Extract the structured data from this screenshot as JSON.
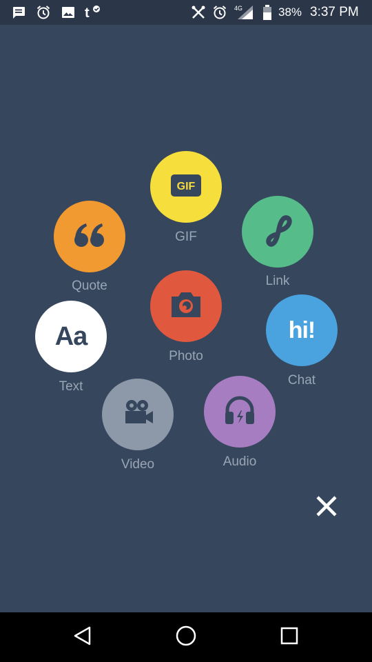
{
  "status_bar": {
    "network": "4G",
    "battery": "38%",
    "time": "3:37 PM",
    "left_icons": [
      "message-icon",
      "alarm-icon",
      "image-icon",
      "tumblr-icon"
    ],
    "right_icons": [
      "tools-icon",
      "alarm-icon",
      "signal-icon",
      "battery-icon"
    ]
  },
  "post_types": {
    "gif": {
      "label": "GIF",
      "icon_text": "GIF",
      "color": "#f6de3d"
    },
    "quote": {
      "label": "Quote",
      "color": "#f29a32"
    },
    "link": {
      "label": "Link",
      "color": "#56bc8a"
    },
    "photo": {
      "label": "Photo",
      "color": "#e0583d"
    },
    "text": {
      "label": "Text",
      "icon_text": "Aa",
      "color": "#ffffff"
    },
    "chat": {
      "label": "Chat",
      "icon_text": "hi!",
      "color": "#4aa3df"
    },
    "video": {
      "label": "Video",
      "color": "#8d99a8"
    },
    "audio": {
      "label": "Audio",
      "color": "#a77dc2"
    }
  },
  "close": {
    "icon": "close-icon"
  },
  "nav_bar": {
    "buttons": [
      "back-icon",
      "home-icon",
      "recents-icon"
    ]
  }
}
